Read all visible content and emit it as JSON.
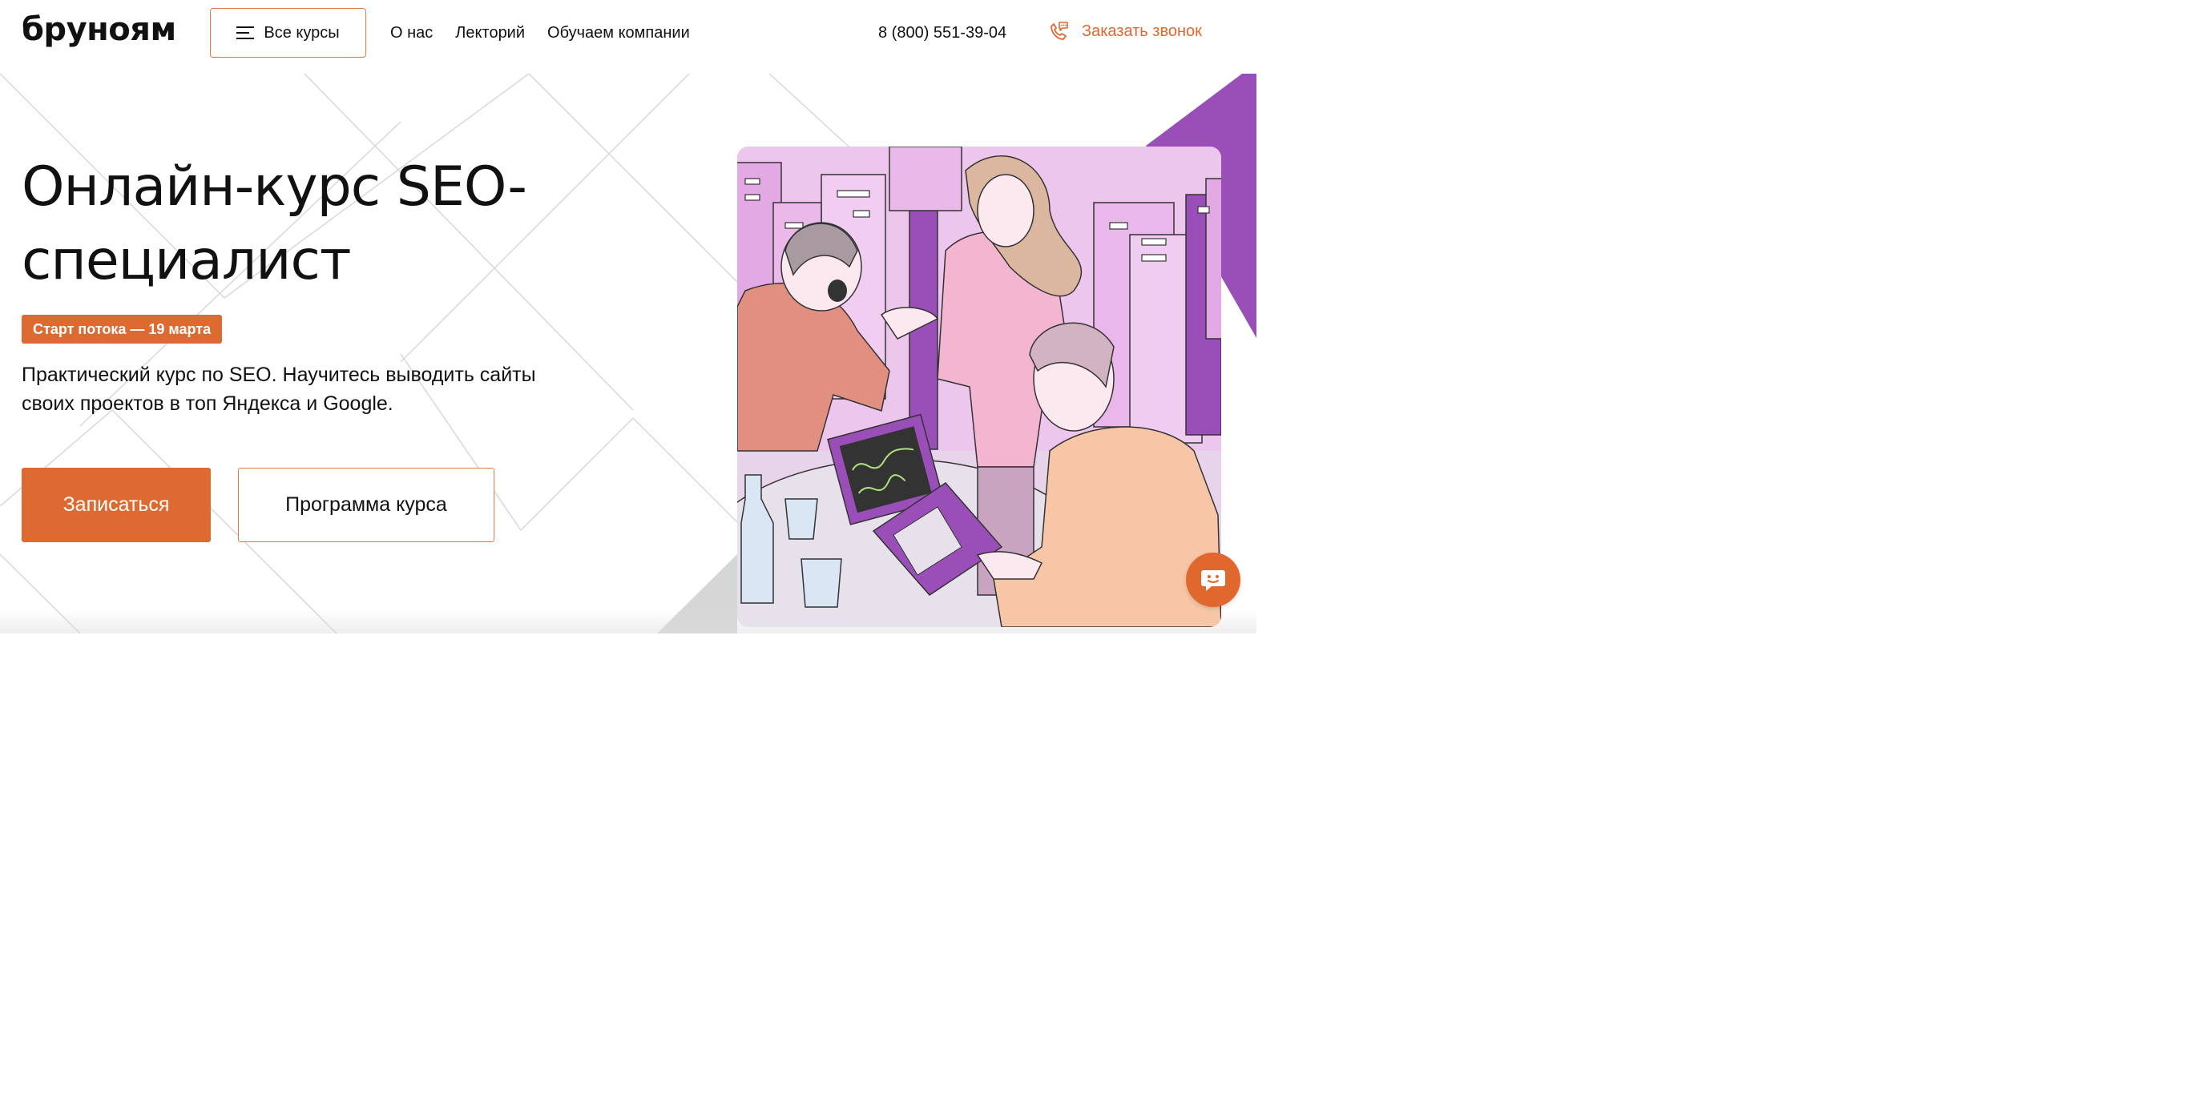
{
  "header": {
    "logo": "бруноям",
    "all_courses": "Все курсы",
    "nav": [
      {
        "label": "О нас"
      },
      {
        "label": "Лекторий"
      },
      {
        "label": "Обучаем компании"
      }
    ],
    "phone": "8 (800) 551-39-04",
    "callback": "Заказать звонок"
  },
  "hero": {
    "title_line1": "Онлайн-курс SEO-",
    "title_line2": "специалист",
    "badge": "Старт потока — 19 марта",
    "subtitle_line1": "Практический курс по SEO. Научитесь выводить сайты",
    "subtitle_line2": "своих проектов в топ Яндекса и Google.",
    "primary_button": "Записаться",
    "secondary_button": "Программа курса"
  },
  "icons": {
    "menu": "menu-icon",
    "phone": "phone-chat-icon",
    "chat": "chat-icon"
  },
  "colors": {
    "accent": "#dd6a30",
    "purple": "#9a4fb8",
    "illustration_bg": "#e9c3ea"
  }
}
